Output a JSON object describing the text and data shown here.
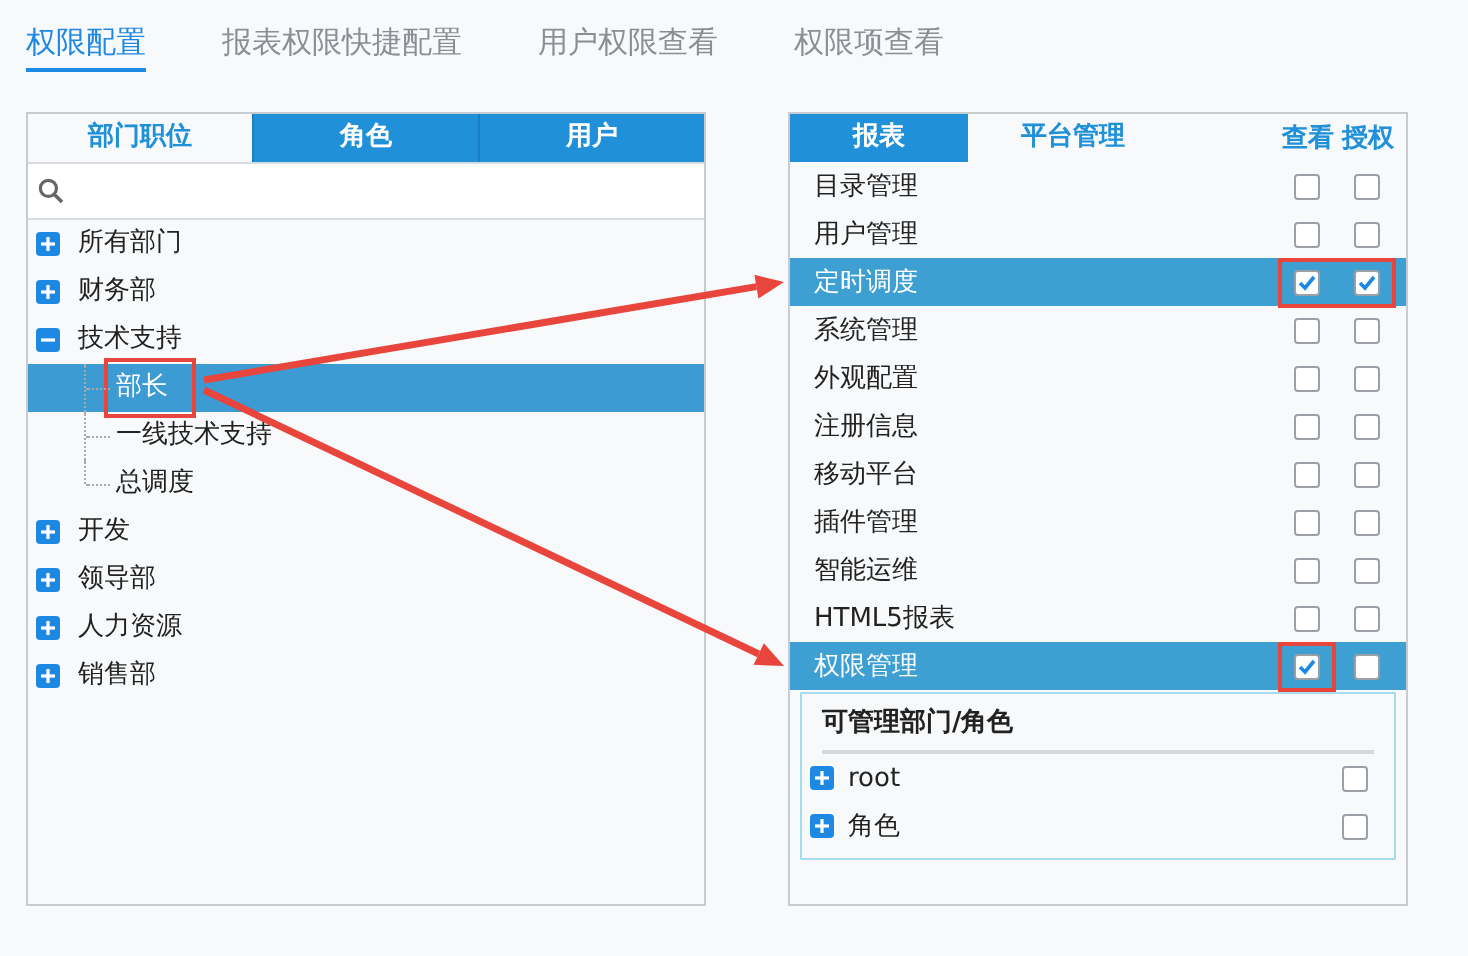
{
  "tabs": [
    {
      "label": "权限配置",
      "selected": true
    },
    {
      "label": "报表权限快捷配置",
      "selected": false
    },
    {
      "label": "用户权限查看",
      "selected": false
    },
    {
      "label": "权限项查看",
      "selected": false
    }
  ],
  "left_panel": {
    "tabs": [
      {
        "label": "部门职位",
        "selected": true
      },
      {
        "label": "角色",
        "selected": false
      },
      {
        "label": "用户",
        "selected": false
      }
    ],
    "tree": [
      {
        "label": "所有部门",
        "expanded": false,
        "selected": false,
        "highlighted": false
      },
      {
        "label": "财务部",
        "expanded": false,
        "selected": false,
        "highlighted": false
      },
      {
        "label": "技术支持",
        "expanded": true,
        "selected": false,
        "highlighted": false,
        "children": [
          {
            "label": "部长",
            "selected": true,
            "highlighted": true
          },
          {
            "label": "一线技术支持",
            "selected": false,
            "highlighted": false
          },
          {
            "label": "总调度",
            "selected": false,
            "highlighted": false
          }
        ]
      },
      {
        "label": "开发",
        "expanded": false,
        "selected": false,
        "highlighted": false
      },
      {
        "label": "领导部",
        "expanded": false,
        "selected": false,
        "highlighted": false
      },
      {
        "label": "人力资源",
        "expanded": false,
        "selected": false,
        "highlighted": false
      },
      {
        "label": "销售部",
        "expanded": false,
        "selected": false,
        "highlighted": false
      }
    ]
  },
  "right_panel": {
    "tabs": [
      {
        "label": "报表",
        "selected": false
      },
      {
        "label": "平台管理",
        "selected": true
      }
    ],
    "columns": [
      "查看",
      "授权"
    ],
    "rows": [
      {
        "label": "目录管理",
        "selected": false,
        "view": false,
        "grant": false,
        "view_highlighted": false,
        "grant_highlighted": false
      },
      {
        "label": "用户管理",
        "selected": false,
        "view": false,
        "grant": false,
        "view_highlighted": false,
        "grant_highlighted": false
      },
      {
        "label": "定时调度",
        "selected": true,
        "view": true,
        "grant": true,
        "view_highlighted": true,
        "grant_highlighted": true
      },
      {
        "label": "系统管理",
        "selected": false,
        "view": false,
        "grant": false,
        "view_highlighted": false,
        "grant_highlighted": false
      },
      {
        "label": "外观配置",
        "selected": false,
        "view": false,
        "grant": false,
        "view_highlighted": false,
        "grant_highlighted": false
      },
      {
        "label": "注册信息",
        "selected": false,
        "view": false,
        "grant": false,
        "view_highlighted": false,
        "grant_highlighted": false
      },
      {
        "label": "移动平台",
        "selected": false,
        "view": false,
        "grant": false,
        "view_highlighted": false,
        "grant_highlighted": false
      },
      {
        "label": "插件管理",
        "selected": false,
        "view": false,
        "grant": false,
        "view_highlighted": false,
        "grant_highlighted": false
      },
      {
        "label": "智能运维",
        "selected": false,
        "view": false,
        "grant": false,
        "view_highlighted": false,
        "grant_highlighted": false
      },
      {
        "label": "HTML5报表",
        "selected": false,
        "view": false,
        "grant": false,
        "view_highlighted": false,
        "grant_highlighted": false
      },
      {
        "label": "权限管理",
        "selected": true,
        "view": true,
        "grant": false,
        "view_highlighted": true,
        "grant_highlighted": false
      }
    ],
    "sub_panel": {
      "title": "可管理部门/角色",
      "items": [
        {
          "label": "root",
          "expanded": false,
          "checked": false
        },
        {
          "label": "角色",
          "expanded": false,
          "checked": false
        }
      ]
    }
  }
}
